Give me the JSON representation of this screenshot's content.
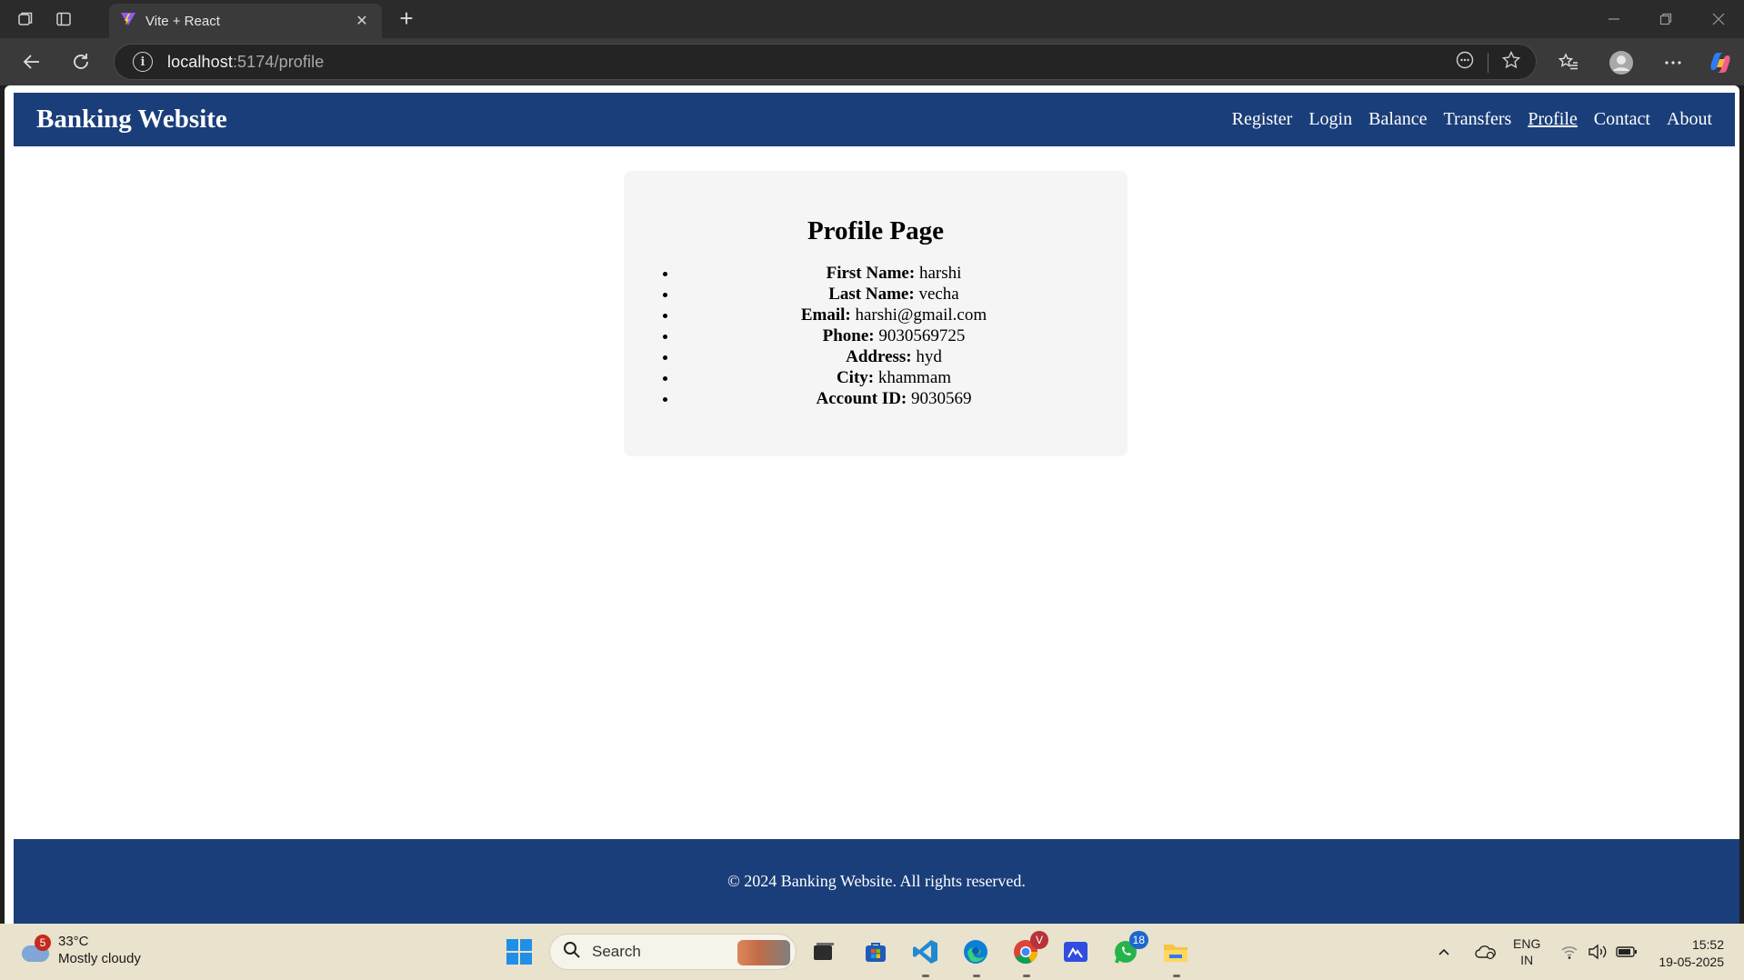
{
  "browser": {
    "tab_title": "Vite + React",
    "url_host": "localhost",
    "url_path": ":5174/profile"
  },
  "site": {
    "brand": "Banking Website",
    "nav": [
      "Register",
      "Login",
      "Balance",
      "Transfers",
      "Profile",
      "Contact",
      "About"
    ],
    "active_nav": "Profile",
    "colors": {
      "header_bg": "#1a3e7a",
      "card_bg": "#f5f5f5"
    }
  },
  "profile": {
    "title": "Profile Page",
    "fields": [
      {
        "label": "First Name:",
        "value": "harshi"
      },
      {
        "label": "Last Name:",
        "value": "vecha"
      },
      {
        "label": "Email:",
        "value": "harshi@gmail.com"
      },
      {
        "label": "Phone:",
        "value": "9030569725"
      },
      {
        "label": "Address:",
        "value": "hyd"
      },
      {
        "label": "City:",
        "value": "khammam"
      },
      {
        "label": "Account ID:",
        "value": "9030569"
      }
    ]
  },
  "footer": {
    "text": "© 2024 Banking Website. All rights reserved."
  },
  "taskbar": {
    "weather_badge": "5",
    "temperature": "33°C",
    "condition": "Mostly cloudy",
    "search_placeholder": "Search",
    "whatsapp_badge": "18",
    "chrome_badge": "V",
    "lang_line1": "ENG",
    "lang_line2": "IN",
    "time": "15:52",
    "date": "19-05-2025"
  }
}
